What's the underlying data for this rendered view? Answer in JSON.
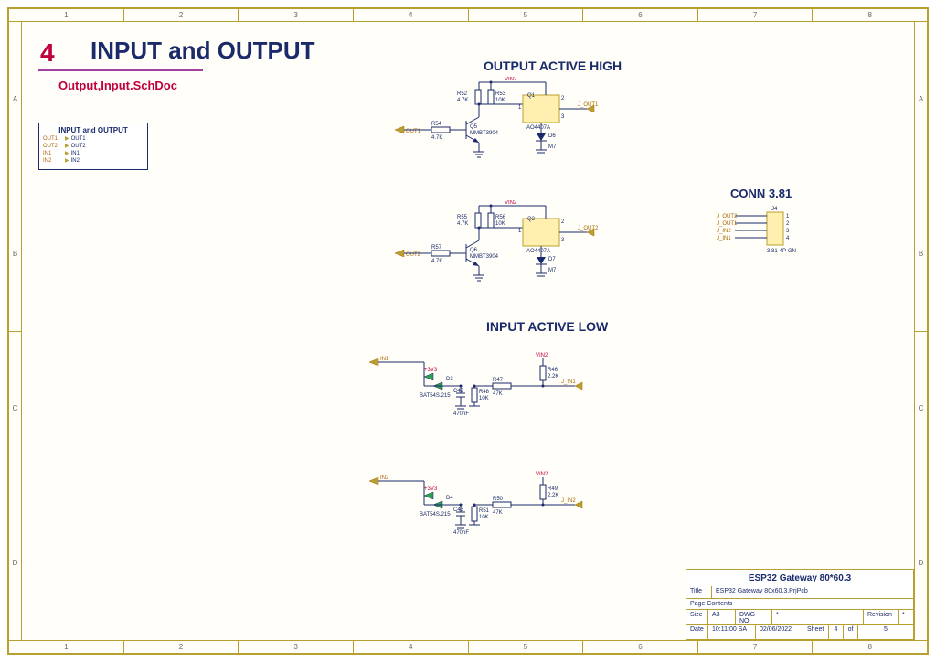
{
  "section": {
    "number": "4",
    "title": "INPUT and OUTPUT",
    "subdoc": "Output,Input.SchDoc"
  },
  "legend": {
    "title": "INPUT and OUTPUT",
    "rows": [
      {
        "sig": "OUT1",
        "net": "OUT1"
      },
      {
        "sig": "OUT2",
        "net": "OUT2"
      },
      {
        "sig": "IN1",
        "net": "IN1"
      },
      {
        "sig": "IN2",
        "net": "IN2"
      }
    ]
  },
  "subheadings": {
    "out_high": "OUTPUT ACTIVE HIGH",
    "in_low": "INPUT ACTIVE LOW"
  },
  "output1": {
    "net_in": "OUT1",
    "r_in": {
      "ref": "R54",
      "val": "4.7K"
    },
    "q_npn": {
      "ref": "Q5",
      "part": "MMBT3904"
    },
    "r_pull1": {
      "ref": "R52",
      "val": "4.7K"
    },
    "r_pull2": {
      "ref": "R53",
      "val": "10K"
    },
    "q_pmos": {
      "ref": "Q1",
      "part": "AO4407A"
    },
    "diode_out": {
      "ref": "D6",
      "part": "M7"
    },
    "vcc": "VIN2",
    "net_out": "J_OUT1",
    "mos_pins": {
      "g": "1",
      "s": "2",
      "d": "3"
    }
  },
  "output2": {
    "net_in": "OUT2",
    "r_in": {
      "ref": "R57",
      "val": "4.7K"
    },
    "q_npn": {
      "ref": "Q6",
      "part": "MMBT3904"
    },
    "r_pull1": {
      "ref": "R55",
      "val": "4.7K"
    },
    "r_pull2": {
      "ref": "R56",
      "val": "10K"
    },
    "q_pmos": {
      "ref": "Q2",
      "part": "AO4407A"
    },
    "diode_out": {
      "ref": "D7",
      "part": "M7"
    },
    "vcc": "VIN2",
    "net_out": "J_OUT2",
    "mos_pins": {
      "g": "1",
      "s": "2",
      "d": "3"
    }
  },
  "input1": {
    "net_in": "IN1",
    "v33": "+3V3",
    "diode": {
      "ref": "D3",
      "part": "BAT54S.215"
    },
    "cap": {
      "ref": "C42",
      "val": "470nF"
    },
    "r_series": {
      "ref": "R47",
      "val": "47K"
    },
    "r_pd": {
      "ref": "R48",
      "val": "10K"
    },
    "r_pu": {
      "ref": "R46",
      "val": "2.2K"
    },
    "vcc": "VIN2",
    "net_out": "J_IN1"
  },
  "input2": {
    "net_in": "IN2",
    "v33": "+3V3",
    "diode": {
      "ref": "D4",
      "part": "BAT54S.215"
    },
    "cap": {
      "ref": "C43",
      "val": "470nF"
    },
    "r_series": {
      "ref": "R50",
      "val": "47K"
    },
    "r_pd": {
      "ref": "R51",
      "val": "10K"
    },
    "r_pu": {
      "ref": "R49",
      "val": "2.2K"
    },
    "vcc": "VIN2",
    "net_out": "J_IN2"
  },
  "connector": {
    "title": "CONN 3.81",
    "ref": "J4",
    "part": "3.81-4P-GN",
    "pins": [
      "J_OUT2",
      "J_OUT1",
      "J_IN2",
      "J_IN1"
    ],
    "nums": [
      "1",
      "2",
      "3",
      "4"
    ]
  },
  "titleblock": {
    "project": "ESP32 Gateway 80*60.3",
    "title_label": "Title",
    "title_value": "ESP32 Gateway 80x60.3.PrjPcb",
    "page_label": "Page Contents",
    "size_label": "Size",
    "size_value": "A3",
    "dwg_label": "DWG NO.",
    "dwg_value": "*",
    "rev_label": "Revision",
    "rev_value": "*",
    "date_label": "Date",
    "time": "10:11:00 SA",
    "date": "02/06/2022",
    "sheet_label": "Sheet",
    "sheet_num": "4",
    "sheet_of_label": "of",
    "sheet_total": "5"
  },
  "ruler": {
    "cols": [
      "1",
      "2",
      "3",
      "4",
      "5",
      "6",
      "7",
      "8"
    ],
    "rows": [
      "A",
      "B",
      "C",
      "D"
    ]
  }
}
